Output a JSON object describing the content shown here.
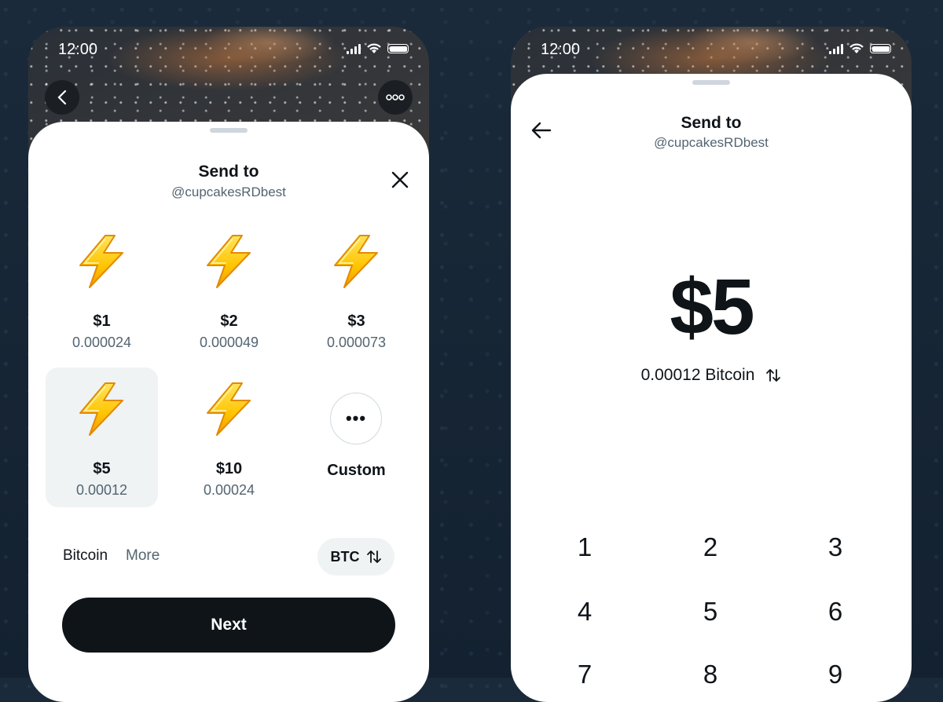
{
  "status_bar": {
    "time": "12:00"
  },
  "left": {
    "title": "Send to",
    "handle": "@cupcakesRDbest",
    "options": [
      {
        "amount": "$1",
        "btc": "0.000024"
      },
      {
        "amount": "$2",
        "btc": "0.000049"
      },
      {
        "amount": "$3",
        "btc": "0.000073"
      },
      {
        "amount": "$5",
        "btc": "0.00012",
        "selected": true
      },
      {
        "amount": "$10",
        "btc": "0.00024"
      }
    ],
    "custom_label": "Custom",
    "custom_icon_text": "•••",
    "tabs": [
      "Bitcoin",
      "More"
    ],
    "currency_toggle": "BTC",
    "next_label": "Next"
  },
  "right": {
    "title": "Send to",
    "handle": "@cupcakesRDbest",
    "amount": "$5",
    "btc_amount": "0.00012 Bitcoin",
    "keypad": [
      "1",
      "2",
      "3",
      "4",
      "5",
      "6",
      "7",
      "8",
      "9"
    ]
  },
  "colors": {
    "accent": "#0f1419",
    "muted": "#536471",
    "selected_bg": "#eff3f4"
  },
  "icons": [
    "back-icon",
    "more-icon",
    "close-icon",
    "lightning-icon",
    "swap-icon",
    "signal-icon",
    "wifi-icon",
    "battery-icon",
    "arrow-left-icon"
  ]
}
